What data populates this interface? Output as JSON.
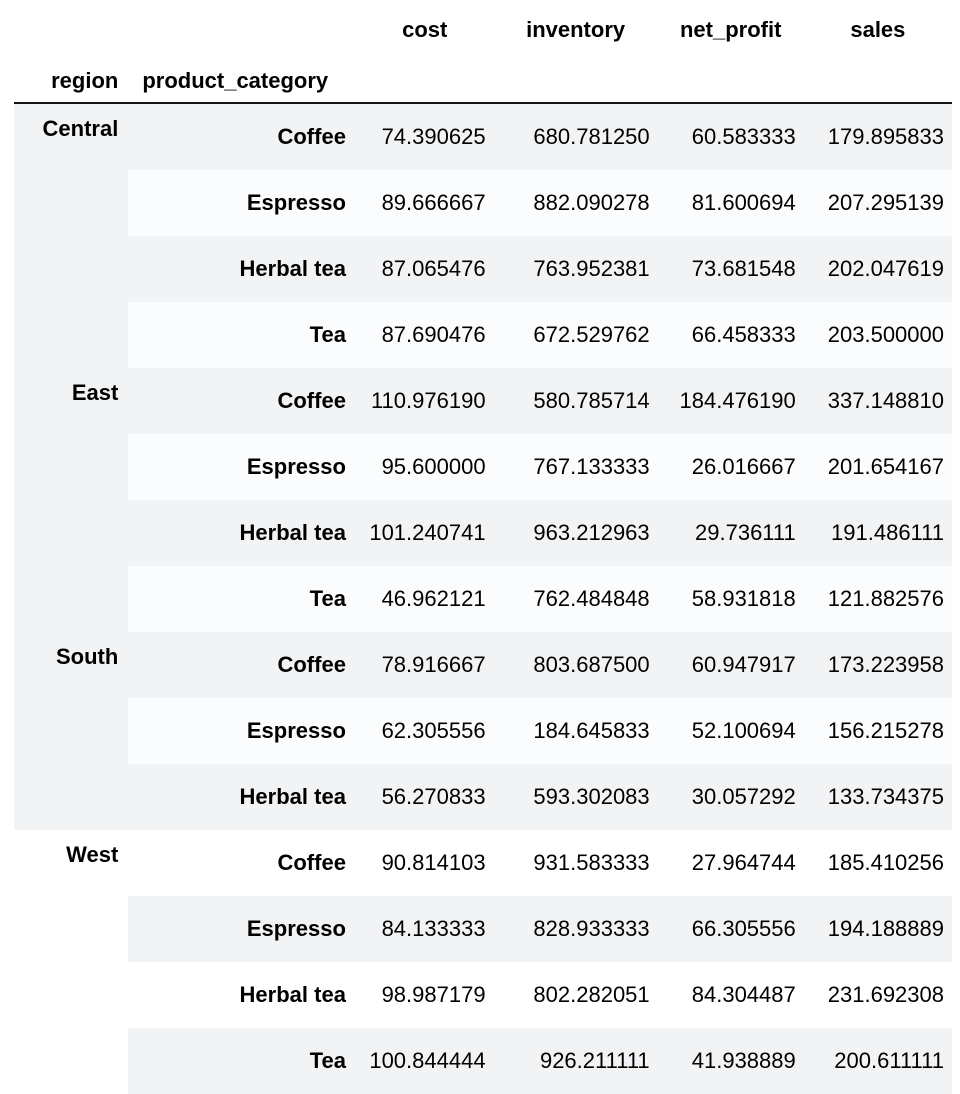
{
  "table": {
    "index_names": {
      "level0": "region",
      "level1": "product_category"
    },
    "columns": [
      "cost",
      "inventory",
      "net_profit",
      "sales"
    ],
    "colors": {
      "stripe_gray": "#f2f3f5",
      "stripe_white": "#fbfcfd",
      "page_background": "#ffffff",
      "header_rule": "#14131a",
      "text": "#000000"
    },
    "rows": [
      {
        "region": "Central",
        "product_category": "Coffee",
        "cost": "74.390625",
        "inventory": "680.781250",
        "net_profit": "60.583333",
        "sales": "179.895833",
        "region_shown": true,
        "region_bg": "gray",
        "data_bg": "gray"
      },
      {
        "region": "Central",
        "product_category": "Espresso",
        "cost": "89.666667",
        "inventory": "882.090278",
        "net_profit": "81.600694",
        "sales": "207.295139",
        "region_shown": false,
        "region_bg": "gray",
        "data_bg": "white"
      },
      {
        "region": "Central",
        "product_category": "Herbal tea",
        "cost": "87.065476",
        "inventory": "763.952381",
        "net_profit": "73.681548",
        "sales": "202.047619",
        "region_shown": false,
        "region_bg": "gray",
        "data_bg": "gray"
      },
      {
        "region": "Central",
        "product_category": "Tea",
        "cost": "87.690476",
        "inventory": "672.529762",
        "net_profit": "66.458333",
        "sales": "203.500000",
        "region_shown": false,
        "region_bg": "gray",
        "data_bg": "white"
      },
      {
        "region": "East",
        "product_category": "Coffee",
        "cost": "110.976190",
        "inventory": "580.785714",
        "net_profit": "184.476190",
        "sales": "337.148810",
        "region_shown": true,
        "region_bg": "gray",
        "data_bg": "gray"
      },
      {
        "region": "East",
        "product_category": "Espresso",
        "cost": "95.600000",
        "inventory": "767.133333",
        "net_profit": "26.016667",
        "sales": "201.654167",
        "region_shown": false,
        "region_bg": "gray",
        "data_bg": "white"
      },
      {
        "region": "East",
        "product_category": "Herbal tea",
        "cost": "101.240741",
        "inventory": "963.212963",
        "net_profit": "29.736111",
        "sales": "191.486111",
        "region_shown": false,
        "region_bg": "gray",
        "data_bg": "gray"
      },
      {
        "region": "East",
        "product_category": "Tea",
        "cost": "46.962121",
        "inventory": "762.484848",
        "net_profit": "58.931818",
        "sales": "121.882576",
        "region_shown": false,
        "region_bg": "gray",
        "data_bg": "white"
      },
      {
        "region": "South",
        "product_category": "Coffee",
        "cost": "78.916667",
        "inventory": "803.687500",
        "net_profit": "60.947917",
        "sales": "173.223958",
        "region_shown": true,
        "region_bg": "gray",
        "data_bg": "gray"
      },
      {
        "region": "South",
        "product_category": "Espresso",
        "cost": "62.305556",
        "inventory": "184.645833",
        "net_profit": "52.100694",
        "sales": "156.215278",
        "region_shown": false,
        "region_bg": "gray",
        "data_bg": "white"
      },
      {
        "region": "South",
        "product_category": "Herbal tea",
        "cost": "56.270833",
        "inventory": "593.302083",
        "net_profit": "30.057292",
        "sales": "133.734375",
        "region_shown": false,
        "region_bg": "gray",
        "data_bg": "gray"
      },
      {
        "region": "West",
        "product_category": "Coffee",
        "cost": "90.814103",
        "inventory": "931.583333",
        "net_profit": "27.964744",
        "sales": "185.410256",
        "region_shown": true,
        "region_bg": "plain",
        "data_bg": "plain"
      },
      {
        "region": "West",
        "product_category": "Espresso",
        "cost": "84.133333",
        "inventory": "828.933333",
        "net_profit": "66.305556",
        "sales": "194.188889",
        "region_shown": false,
        "region_bg": "plain",
        "data_bg": "gray"
      },
      {
        "region": "West",
        "product_category": "Herbal tea",
        "cost": "98.987179",
        "inventory": "802.282051",
        "net_profit": "84.304487",
        "sales": "231.692308",
        "region_shown": false,
        "region_bg": "plain",
        "data_bg": "plain"
      },
      {
        "region": "West",
        "product_category": "Tea",
        "cost": "100.844444",
        "inventory": "926.211111",
        "net_profit": "41.938889",
        "sales": "200.611111",
        "region_shown": false,
        "region_bg": "plain",
        "data_bg": "gray"
      }
    ]
  }
}
